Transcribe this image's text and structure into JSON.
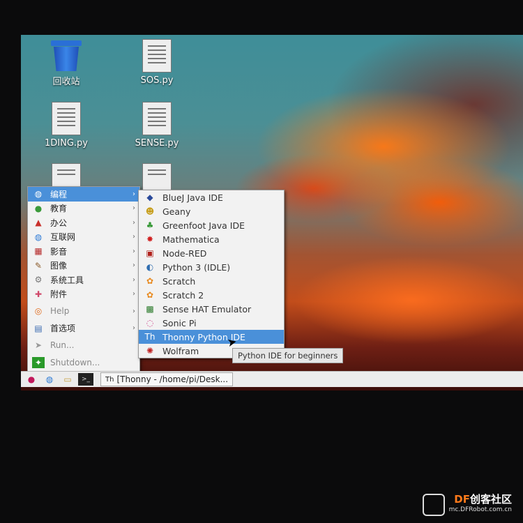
{
  "desktop": {
    "icons": [
      {
        "label": "回收站",
        "type": "trash"
      },
      {
        "label": "SOS.py",
        "type": "file"
      },
      {
        "label": "1DING.py",
        "type": "file"
      },
      {
        "label": "SENSE.py",
        "type": "file"
      }
    ]
  },
  "menu": {
    "items": [
      {
        "label": "编程",
        "icon": "globe-icon",
        "has_submenu": true,
        "selected": true
      },
      {
        "label": "教育",
        "icon": "education-icon",
        "has_submenu": true
      },
      {
        "label": "办公",
        "icon": "office-icon",
        "has_submenu": true
      },
      {
        "label": "互联网",
        "icon": "internet-icon",
        "has_submenu": true
      },
      {
        "label": "影音",
        "icon": "media-icon",
        "has_submenu": true
      },
      {
        "label": "图像",
        "icon": "graphics-icon",
        "has_submenu": true
      },
      {
        "label": "系统工具",
        "icon": "system-tools-icon",
        "has_submenu": true
      },
      {
        "label": "附件",
        "icon": "accessories-icon",
        "has_submenu": true
      },
      {
        "label": "Help",
        "icon": "help-icon",
        "has_submenu": true
      },
      {
        "label": "首选项",
        "icon": "preferences-icon",
        "has_submenu": true
      },
      {
        "label": "Run...",
        "icon": "run-icon",
        "has_submenu": false
      },
      {
        "label": "Shutdown...",
        "icon": "shutdown-icon",
        "has_submenu": false
      }
    ]
  },
  "submenu": {
    "items": [
      {
        "label": "BlueJ Java IDE",
        "icon": "bluej-icon"
      },
      {
        "label": "Geany",
        "icon": "geany-icon"
      },
      {
        "label": "Greenfoot Java IDE",
        "icon": "greenfoot-icon"
      },
      {
        "label": "Mathematica",
        "icon": "mathematica-icon"
      },
      {
        "label": "Node-RED",
        "icon": "node-red-icon"
      },
      {
        "label": "Python 3 (IDLE)",
        "icon": "python-icon"
      },
      {
        "label": "Scratch",
        "icon": "scratch-icon"
      },
      {
        "label": "Scratch 2",
        "icon": "scratch2-icon"
      },
      {
        "label": "Sense HAT Emulator",
        "icon": "sense-hat-icon"
      },
      {
        "label": "Sonic Pi",
        "icon": "sonic-pi-icon"
      },
      {
        "label": "Thonny Python IDE",
        "icon": "thonny-icon",
        "selected": true
      },
      {
        "label": "Wolfram",
        "icon": "wolfram-icon"
      }
    ]
  },
  "tooltip": "Python IDE for beginners",
  "taskbar": {
    "task_label": "[Thonny  -  /home/pi/Desk..."
  },
  "watermark": {
    "brand_dim": "DF",
    "brand": "创客社区",
    "url": "mc.DFRobot.com.cn"
  },
  "colors": {
    "selection": "#4a90d9",
    "menu_bg": "#f2f2f2",
    "brand_orange": "#ff7a1a"
  }
}
